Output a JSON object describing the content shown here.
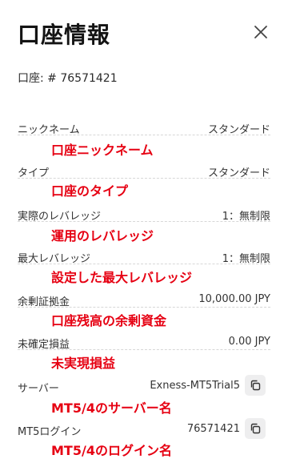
{
  "header": {
    "title": "口座情報",
    "close_icon": "close-icon"
  },
  "account": {
    "label": "口座:",
    "number": "# 76571421"
  },
  "rows": [
    {
      "label": "ニックネーム",
      "value": "スタンダード"
    },
    {
      "label": "タイプ",
      "value": "スタンダード"
    },
    {
      "label": "実際のレバレッジ",
      "value": "1：無制限"
    },
    {
      "label": "最大レバレッジ",
      "value": "1：無制限"
    },
    {
      "label": "余剰証拠金",
      "value": "10,000.00 JPY"
    },
    {
      "label": "未確定損益",
      "value": "0.00 JPY"
    },
    {
      "label": "サーバー",
      "value": "Exness-MT5Trial5",
      "copy_icon": "copy-icon"
    },
    {
      "label": "MT5ログイン",
      "value": "76571421",
      "copy_icon": "copy-icon"
    }
  ],
  "annotations": [
    "口座ニックネーム",
    "口座のタイプ",
    "運用のレバレッジ",
    "設定した最大レバレッジ",
    "口座残高の余剰資金",
    "未実現損益",
    "MT5/4のサーバー名",
    "MT5/4のログイン名"
  ],
  "colors": {
    "annotation": "#e60012",
    "copy_button_bg": "#eeeeef"
  }
}
